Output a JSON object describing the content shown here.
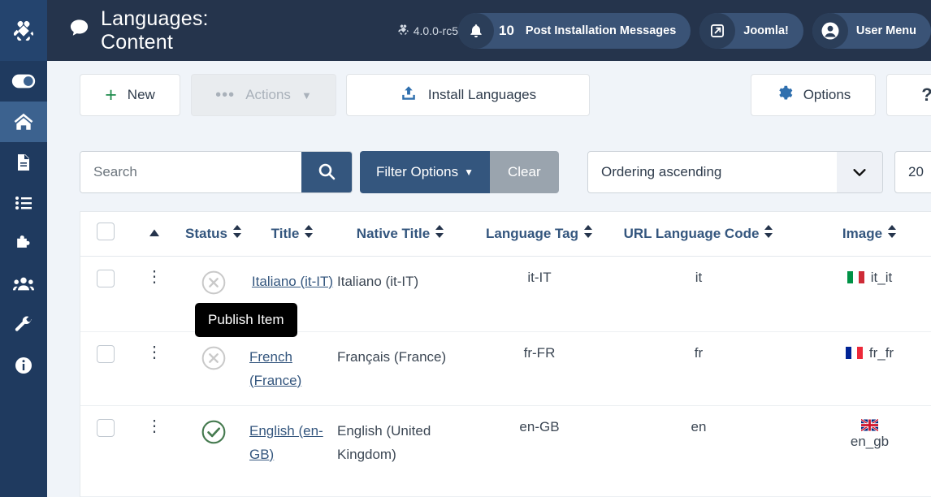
{
  "sidebar": {
    "brand_icon": "joomla-logo-icon",
    "items": [
      {
        "name": "toggle-menu",
        "icon": "toggle-switch-icon",
        "active": false
      },
      {
        "name": "home",
        "icon": "home-icon",
        "active": true
      },
      {
        "name": "content",
        "icon": "document-icon",
        "active": false
      },
      {
        "name": "menus",
        "icon": "list-icon",
        "active": false
      },
      {
        "name": "components",
        "icon": "puzzle-icon",
        "active": false
      },
      {
        "name": "users",
        "icon": "users-icon",
        "active": false
      },
      {
        "name": "system",
        "icon": "wrench-icon",
        "active": false
      },
      {
        "name": "help",
        "icon": "info-icon",
        "active": false
      }
    ]
  },
  "header": {
    "title": "Languages: Content",
    "title_icon": "speech-bubble-icon",
    "version": "4.0.0-rc5",
    "version_icon": "joomla-logo-icon",
    "notifications": {
      "icon": "bell-icon",
      "count": "10",
      "label": "Post Installation Messages"
    },
    "joomla_link": {
      "icon": "external-link-icon",
      "label": "Joomla!"
    },
    "user_menu": {
      "icon": "user-avatar-icon",
      "label": "User Menu"
    }
  },
  "toolbar": {
    "new_label": "New",
    "new_icon": "plus-icon",
    "actions_label": "Actions",
    "actions_icon": "ellipsis-icon",
    "actions_caret": "chevron-down-icon",
    "actions_disabled": true,
    "install_label": "Install Languages",
    "install_icon": "upload-icon",
    "options_label": "Options",
    "options_icon": "gear-icon",
    "help_label": "?"
  },
  "filters": {
    "search_value": "",
    "search_placeholder": "Search",
    "search_icon": "search-icon",
    "filter_options_label": "Filter Options",
    "filter_options_caret": "chevron-down-icon",
    "clear_label": "Clear",
    "ordering_value": "Ordering ascending",
    "ordering_caret": "chevron-down-icon",
    "limit_value": "20"
  },
  "table": {
    "columns": [
      {
        "key": "check",
        "label": "",
        "sortable": false
      },
      {
        "key": "drag",
        "label": "",
        "sortable": false
      },
      {
        "key": "status",
        "label": "Status",
        "sortable": true
      },
      {
        "key": "title",
        "label": "Title",
        "sortable": true
      },
      {
        "key": "native",
        "label": "Native Title",
        "sortable": true
      },
      {
        "key": "tag",
        "label": "Language Tag",
        "sortable": true
      },
      {
        "key": "url",
        "label": "URL Language Code",
        "sortable": true
      },
      {
        "key": "image",
        "label": "Image",
        "sortable": true
      }
    ],
    "rows": [
      {
        "status": "unpublished",
        "status_icon": "circle-x-icon",
        "title": "Italiano (it-IT)",
        "native": "Italiano (it-IT)",
        "tag": "it-IT",
        "url": "it",
        "image": "it_it",
        "flag": "italy-flag-icon",
        "flag_colors": [
          "#009246",
          "#ffffff",
          "#ce2b37"
        ]
      },
      {
        "status": "unpublished",
        "status_icon": "circle-x-icon",
        "title": "French (France)",
        "native": "Français (France)",
        "tag": "fr-FR",
        "url": "fr",
        "image": "fr_fr",
        "flag": "france-flag-icon",
        "flag_colors": [
          "#002395",
          "#ffffff",
          "#ed2939"
        ]
      },
      {
        "status": "published",
        "status_icon": "circle-check-icon",
        "title": "English (en-GB)",
        "native": "English (United Kingdom)",
        "tag": "en-GB",
        "url": "en",
        "image": "en_gb",
        "flag": "united-kingdom-flag-icon",
        "flag_colors": [
          "#00247d",
          "#ffffff",
          "#cf142b"
        ]
      }
    ]
  },
  "tooltip": {
    "text": "Publish Item"
  },
  "colors": {
    "sidebar_bg": "#1f3a5f",
    "header_bg": "#25344c",
    "accent_blue": "#34567e",
    "page_bg": "#f0f4f9",
    "published_green": "#457a4f",
    "unpublished_grey": "#c9c9c9"
  }
}
